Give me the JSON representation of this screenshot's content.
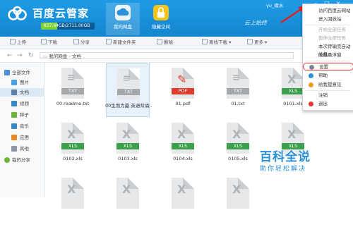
{
  "app": {
    "title": "百度云管家",
    "quota_text": "837.94GB/2711.00GB",
    "quota_used_fraction": 0.309,
    "username": "yu_缘水",
    "slogan": "云上始终"
  },
  "nav_tabs": [
    {
      "label": "我的网盘",
      "icon": "cloud-icon",
      "active": true
    },
    {
      "label": "隐藏空间",
      "icon": "lock-icon",
      "active": false
    }
  ],
  "toolbar": [
    {
      "label": "上传",
      "icon": "upload-icon"
    },
    {
      "label": "下载",
      "icon": "download-icon"
    },
    {
      "label": "分享",
      "icon": "share-icon"
    },
    {
      "label": "新建文件夹",
      "icon": "new-folder-icon"
    },
    {
      "label": "删除",
      "icon": "delete-icon"
    },
    {
      "label": "离线下载",
      "icon": "offline-download-icon"
    },
    {
      "label": "更多",
      "icon": "more-icon"
    }
  ],
  "breadcrumb": [
    "我的网盘",
    "文档"
  ],
  "sidebar": [
    {
      "label": "全部文件",
      "icon": "all-files-icon",
      "color": "#4a90d9"
    },
    {
      "label": "图片",
      "icon": "image-icon",
      "color": "#4aa0e0"
    },
    {
      "label": "文档",
      "icon": "document-icon",
      "color": "#5b7fa6",
      "selected": true
    },
    {
      "label": "视频",
      "icon": "video-icon",
      "color": "#3a87c8"
    },
    {
      "label": "种子",
      "icon": "bt-seed-icon",
      "color": "#6fb33b"
    },
    {
      "label": "音乐",
      "icon": "music-icon",
      "color": "#3a87c8"
    },
    {
      "label": "应用",
      "icon": "app-icon",
      "color": "#e58a2a"
    },
    {
      "label": "其他",
      "icon": "other-icon",
      "color": "#8a96a3"
    },
    {
      "label": "我的分享",
      "icon": "my-share-icon",
      "color": "#6fb33b"
    }
  ],
  "files_row1": [
    {
      "name": "00.readme.txt",
      "type": "TXT",
      "badge_color": "#a3a8ad"
    },
    {
      "name": "00生而为赢 英语背诵...",
      "type": "TXT",
      "badge_color": "#a3a8ad",
      "selected": true
    },
    {
      "name": "01.pdf",
      "type": "PDF",
      "badge_color": "#e03b2a"
    },
    {
      "name": "01.txt",
      "type": "TXT",
      "badge_color": "#a3a8ad"
    },
    {
      "name": "0101.xls",
      "type": "XLS",
      "badge_color": "#3aa04b"
    }
  ],
  "files_row2": [
    {
      "name": "0102.xls",
      "type": "XLS",
      "badge_color": "#3aa04b"
    },
    {
      "name": "0103.xls",
      "type": "XLS",
      "badge_color": "#3aa04b"
    },
    {
      "name": "0104.xls",
      "type": "XLS",
      "badge_color": "#3aa04b"
    },
    {
      "name": "0105.xls",
      "type": "XLS",
      "badge_color": "#3aa04b"
    },
    {
      "name": "",
      "type": "XLS",
      "badge_color": "#3aa04b"
    }
  ],
  "menu": [
    {
      "label": "访问百度云网站",
      "icon": ""
    },
    {
      "label": "进入回收站",
      "icon": ""
    },
    {
      "label": "开始全部任务",
      "icon": "",
      "disabled": true
    },
    {
      "label": "暂停全部任务",
      "icon": "",
      "disabled": true
    },
    {
      "label": "本次传输完自动关机",
      "icon": ""
    },
    {
      "label": "隐藏悬浮窗",
      "icon": ""
    },
    {
      "label": "设置",
      "icon": "settings-icon",
      "icon_color": "#7a8796",
      "highlight": true
    },
    {
      "label": "帮助",
      "icon": "help-icon",
      "icon_color": "#2a8fd8"
    },
    {
      "label": "给我提意见",
      "icon": "feedback-icon",
      "icon_color": "#f0a020"
    },
    {
      "label": "注销",
      "icon": ""
    },
    {
      "label": "退出",
      "icon": "exit-icon",
      "icon_color": "#e33"
    }
  ],
  "watermark": {
    "title": "百科全说",
    "subtitle": "助你轻松解决"
  },
  "colors": {
    "brand": "#1a8fd9",
    "highlight_red": "#e33333"
  }
}
